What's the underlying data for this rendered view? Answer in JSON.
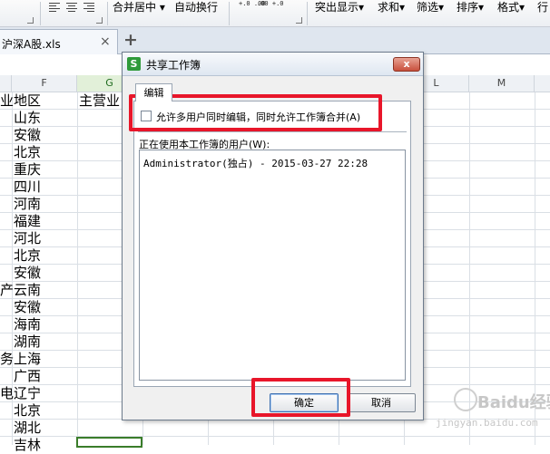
{
  "ribbon": {
    "merge_center": "合并居中",
    "auto_wrap": "自动换行",
    "highlight": "突出显示",
    "sum": "求和",
    "filter": "筛选",
    "sort": "排序",
    "format": "格式",
    "row": "行",
    "decimal_increase": "+.0 .00",
    "decimal_decrease": ".00 +.0"
  },
  "tabs": {
    "file_name": "沪深A股.xls",
    "close_glyph": "×",
    "new_tab_glyph": "+"
  },
  "columns": [
    "F",
    "G",
    "L",
    "M"
  ],
  "cells": {
    "e_header_partial": "业",
    "f_header": "地区",
    "g_header": "主营业",
    "e_fragments": [
      "产",
      "务",
      "电"
    ],
    "regions": [
      "山东",
      "安徽",
      "北京",
      "重庆",
      "四川",
      "河南",
      "福建",
      "河北",
      "北京",
      "安徽",
      "云南",
      "安徽",
      "海南",
      "湖南",
      "上海",
      "广西",
      "辽宁",
      "北京",
      "湖北",
      "吉林"
    ]
  },
  "dialog": {
    "title": "共享工作簿",
    "close_glyph": "x",
    "tab_label": "编辑",
    "checkbox_label": "允许多用户同时编辑，同时允许工作簿合并(A)",
    "checkbox_checked": false,
    "users_label": "正在使用本工作簿的用户(W):",
    "users": [
      "Administrator(独占) - 2015-03-27 22:28"
    ],
    "ok_label": "确定",
    "cancel_label": "取消"
  },
  "watermark": {
    "brand": "Baidu经验",
    "url": "jingyan.baidu.com"
  },
  "colors": {
    "highlight_red": "#e8162a",
    "selection_green": "#3a7d2a"
  }
}
